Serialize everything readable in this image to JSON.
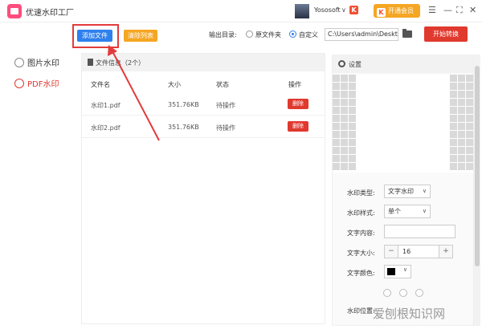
{
  "titlebar": {
    "app_title": "优速水印工厂",
    "user_name": "Yososoft",
    "user_badge": "K",
    "vip_label": "开通会员",
    "vip_icon": "K",
    "minimize": "—",
    "restore": "⛶",
    "close": "✕",
    "menu": "☰",
    "user_chevron": "∨"
  },
  "sidebar": {
    "items": [
      {
        "label": "图片水印",
        "active": false
      },
      {
        "label": "PDF水印",
        "active": true
      }
    ]
  },
  "toolbar": {
    "add_label": "添加文件",
    "clear_label": "清除列表",
    "output_label": "输出目录:",
    "radio_original": "原文件夹",
    "radio_custom": "自定义",
    "output_path": "C:\\Users\\admin\\Deskto",
    "start_label": "开始转换"
  },
  "files": {
    "header": "文件信息（2个）",
    "columns": [
      "文件名",
      "大小",
      "状态",
      "操作"
    ],
    "rows": [
      {
        "name": "水印1.pdf",
        "size": "351.76KB",
        "status": "待操作",
        "action": "删除"
      },
      {
        "name": "水印2.pdf",
        "size": "351.76KB",
        "status": "待操作",
        "action": "删除"
      }
    ]
  },
  "settings": {
    "header": "设置",
    "type_label": "水印类型:",
    "type_value": "文字水印",
    "style_label": "水印样式:",
    "style_value": "单个",
    "content_label": "文字内容:",
    "content_value": "",
    "size_label": "文字大小:",
    "size_value": "16",
    "size_minus": "−",
    "size_plus": "+",
    "color_label": "文字颜色:",
    "color_value": "#000000",
    "position_label": "水印位置:"
  },
  "watermark_text": "爱刨根知识网",
  "colors": {
    "accent_blue": "#2f80ed",
    "accent_red": "#e0392e",
    "accent_orange": "#f5a623"
  }
}
